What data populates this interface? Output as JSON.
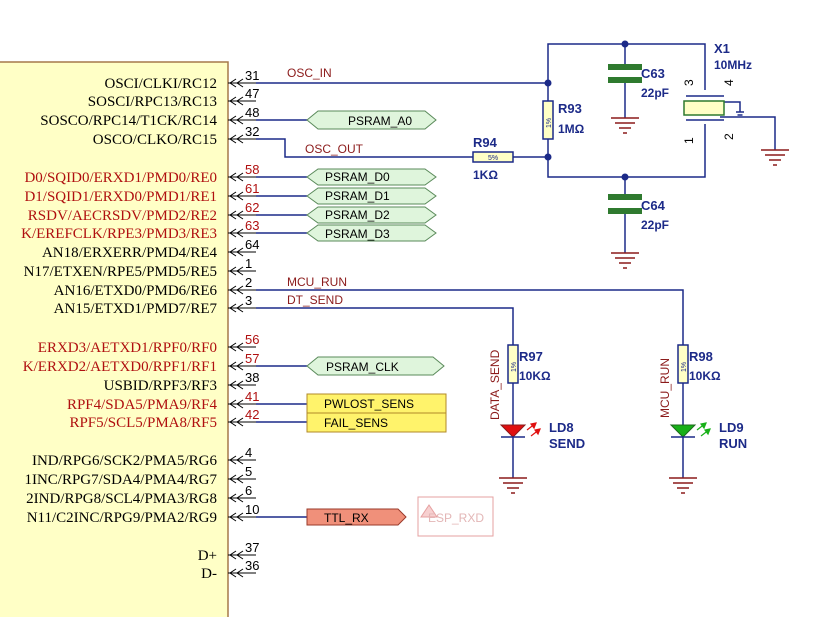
{
  "ic": {
    "pins": [
      {
        "name": "OSCI/CLKI/RC12",
        "num": "31",
        "color": "black"
      },
      {
        "name": "SOSCI/RPC13/RC13",
        "num": "47",
        "color": "black"
      },
      {
        "name": "SOSCO/RPC14/T1CK/RC14",
        "num": "48",
        "color": "black"
      },
      {
        "name": "OSCO/CLKO/RC15",
        "num": "32",
        "color": "black"
      },
      {
        "name": "D0/SQID0/ERXD1/PMD0/RE0",
        "num": "58",
        "color": "red"
      },
      {
        "name": "D1/SQID1/ERXD0/PMD1/RE1",
        "num": "61",
        "color": "red"
      },
      {
        "name": "RSDV/AECRSDV/PMD2/RE2",
        "num": "62",
        "color": "red"
      },
      {
        "name": "K/EREFCLK/RPE3/PMD3/RE3",
        "num": "63",
        "color": "red"
      },
      {
        "name": "AN18/ERXERR/PMD4/RE4",
        "num": "64",
        "color": "black"
      },
      {
        "name": "N17/ETXEN/RPE5/PMD5/RE5",
        "num": "1",
        "color": "black"
      },
      {
        "name": "AN16/ETXD0/PMD6/RE6",
        "num": "2",
        "color": "black"
      },
      {
        "name": "AN15/ETXD1/PMD7/RE7",
        "num": "3",
        "color": "black"
      },
      {
        "name": "ERXD3/AETXD1/RPF0/RF0",
        "num": "56",
        "color": "red"
      },
      {
        "name": "K/ERXD2/AETXD0/RPF1/RF1",
        "num": "57",
        "color": "red"
      },
      {
        "name": "USBID/RPF3/RF3",
        "num": "38",
        "color": "black"
      },
      {
        "name": "RPF4/SDA5/PMA9/RF4",
        "num": "41",
        "color": "red"
      },
      {
        "name": "RPF5/SCL5/PMA8/RF5",
        "num": "42",
        "color": "red"
      },
      {
        "name": "IND/RPG6/SCK2/PMA5/RG6",
        "num": "4",
        "color": "black"
      },
      {
        "name": "1INC/RPG7/SDA4/PMA4/RG7",
        "num": "5",
        "color": "black"
      },
      {
        "name": "2IND/RPG8/SCL4/PMA3/RG8",
        "num": "6",
        "color": "black"
      },
      {
        "name": "N11/C2INC/RPG9/PMA2/RG9",
        "num": "10",
        "color": "black"
      },
      {
        "name": "D+",
        "num": "37",
        "color": "black"
      },
      {
        "name": "D-",
        "num": "36",
        "color": "black"
      }
    ]
  },
  "nets": {
    "osc_in": "OSC_IN",
    "osc_out": "OSC_OUT",
    "mcu_run": "MCU_RUN",
    "dt_send": "DT_SEND",
    "data_send": "DATA_SEND",
    "mcu_run_v": "MCU_RUN"
  },
  "ports": {
    "psram_a0": "PSRAM_A0",
    "psram_d0": "PSRAM_D0",
    "psram_d1": "PSRAM_D1",
    "psram_d2": "PSRAM_D2",
    "psram_d3": "PSRAM_D3",
    "psram_clk": "PSRAM_CLK",
    "pwlost_sens": "PWLOST_SENS",
    "fail_sens": "FAIL_SENS",
    "ttl_rx": "TTL_RX",
    "esp_rxd": "ESP_RXD"
  },
  "components": {
    "x1": {
      "ref": "X1",
      "value": "10MHz",
      "pin1": "1",
      "pin2": "2",
      "pin3": "3",
      "pin4": "4"
    },
    "c63": {
      "ref": "C63",
      "value": "22pF"
    },
    "c64": {
      "ref": "C64",
      "value": "22pF"
    },
    "r93": {
      "ref": "R93",
      "value": "1MΩ",
      "tol": "1%"
    },
    "r94": {
      "ref": "R94",
      "value": "1KΩ",
      "tol": "5%"
    },
    "r97": {
      "ref": "R97",
      "value": "10KΩ",
      "tol": "1%"
    },
    "r98": {
      "ref": "R98",
      "value": "10KΩ",
      "tol": "1%"
    },
    "ld8": {
      "ref": "LD8",
      "value": "SEND"
    },
    "ld9": {
      "ref": "LD9",
      "value": "RUN"
    }
  },
  "colors": {
    "wire": "#1c2a88",
    "ic_body": "#ffffc6",
    "ic_border": "#a5794a",
    "port_green": "#dff5dc",
    "port_yellow": "#fff36b",
    "port_salmon": "#f0907a",
    "pin_red": "#b01010",
    "led_red": "#e01010",
    "led_green": "#18b018"
  }
}
